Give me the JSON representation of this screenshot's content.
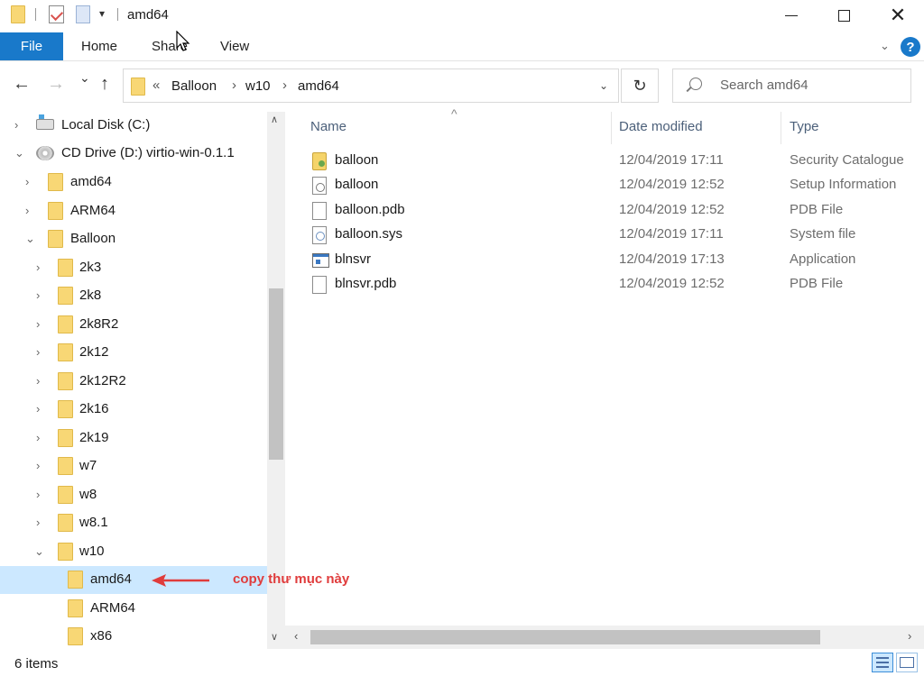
{
  "window": {
    "title": "amd64",
    "minimize": "",
    "maximize": "",
    "close": "✕"
  },
  "ribbon": {
    "tabs": [
      "File",
      "Home",
      "Share",
      "View"
    ]
  },
  "nav": {
    "back": "←",
    "forward": "→",
    "recent": "⌄",
    "up": "↑",
    "overflow": "«",
    "path": [
      "Balloon",
      "w10",
      "amd64"
    ],
    "separator": "›",
    "refresh": "↻"
  },
  "search": {
    "placeholder": "Search amd64"
  },
  "tree": {
    "items": [
      {
        "label": "Local Disk (C:)",
        "icon": "hard-drive-icon",
        "expanded": false
      },
      {
        "label": "CD Drive (D:) virtio-win-0.1.1",
        "icon": "cd-drive-icon",
        "expanded": true
      },
      {
        "label": "amd64",
        "icon": "folder-icon",
        "expanded": false
      },
      {
        "label": "ARM64",
        "icon": "folder-icon",
        "expanded": false
      },
      {
        "label": "Balloon",
        "icon": "folder-icon",
        "expanded": true
      },
      {
        "label": "2k3",
        "icon": "folder-icon",
        "expanded": false
      },
      {
        "label": "2k8",
        "icon": "folder-icon",
        "expanded": false
      },
      {
        "label": "2k8R2",
        "icon": "folder-icon",
        "expanded": false
      },
      {
        "label": "2k12",
        "icon": "folder-icon",
        "expanded": false
      },
      {
        "label": "2k12R2",
        "icon": "folder-icon",
        "expanded": false
      },
      {
        "label": "2k16",
        "icon": "folder-icon",
        "expanded": false
      },
      {
        "label": "2k19",
        "icon": "folder-icon",
        "expanded": false
      },
      {
        "label": "w7",
        "icon": "folder-icon",
        "expanded": false
      },
      {
        "label": "w8",
        "icon": "folder-icon",
        "expanded": false
      },
      {
        "label": "w8.1",
        "icon": "folder-icon",
        "expanded": false
      },
      {
        "label": "w10",
        "icon": "folder-icon",
        "expanded": true
      },
      {
        "label": "amd64",
        "icon": "folder-icon",
        "selected": true
      },
      {
        "label": "ARM64",
        "icon": "folder-icon"
      },
      {
        "label": "x86",
        "icon": "folder-icon"
      }
    ]
  },
  "columns": {
    "name": "Name",
    "date": "Date modified",
    "type": "Type"
  },
  "files": [
    {
      "name": "balloon",
      "date": "12/04/2019 17:11",
      "type": "Security Catalogue",
      "icon": "security-catalog-icon"
    },
    {
      "name": "balloon",
      "date": "12/04/2019 12:52",
      "type": "Setup Information",
      "icon": "setup-info-icon"
    },
    {
      "name": "balloon.pdb",
      "date": "12/04/2019 12:52",
      "type": "PDB File",
      "icon": "document-icon"
    },
    {
      "name": "balloon.sys",
      "date": "12/04/2019 17:11",
      "type": "System file",
      "icon": "system-file-icon"
    },
    {
      "name": "blnsvr",
      "date": "12/04/2019 17:13",
      "type": "Application",
      "icon": "application-icon"
    },
    {
      "name": "blnsvr.pdb",
      "date": "12/04/2019 12:52",
      "type": "PDB File",
      "icon": "document-icon"
    }
  ],
  "status": {
    "count": "6 items"
  },
  "annotation": {
    "text": "copy thư mục này",
    "color": "#e03c3c"
  },
  "colors": {
    "accent": "#1979ca",
    "selection": "#cce8ff"
  }
}
